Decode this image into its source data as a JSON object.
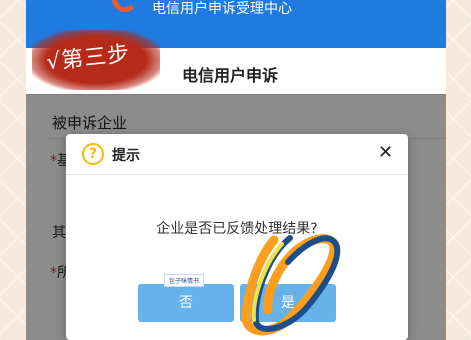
{
  "app": {
    "top_title": "电信用户申诉受理中心"
  },
  "header": {
    "title": "电信用户申诉"
  },
  "annotation": {
    "step_label": "√第三步"
  },
  "form": {
    "section_title": "被申诉企业",
    "field1_required": "*",
    "field1_label": "基",
    "field2_label": "其",
    "field3_required": "*",
    "field3_label": "所"
  },
  "dialog": {
    "title": "提示",
    "icon": "question-icon",
    "close_glyph": "✕",
    "message": "企业是否已反馈处理结果?",
    "no_label": "否",
    "yes_label": "是"
  },
  "sticker": {
    "text": "包子咪情书"
  },
  "colors": {
    "brand_blue": "#1f7be0",
    "button_blue": "#66b2ea",
    "warning_yellow": "#f2b90c",
    "required_red": "#e03030"
  }
}
